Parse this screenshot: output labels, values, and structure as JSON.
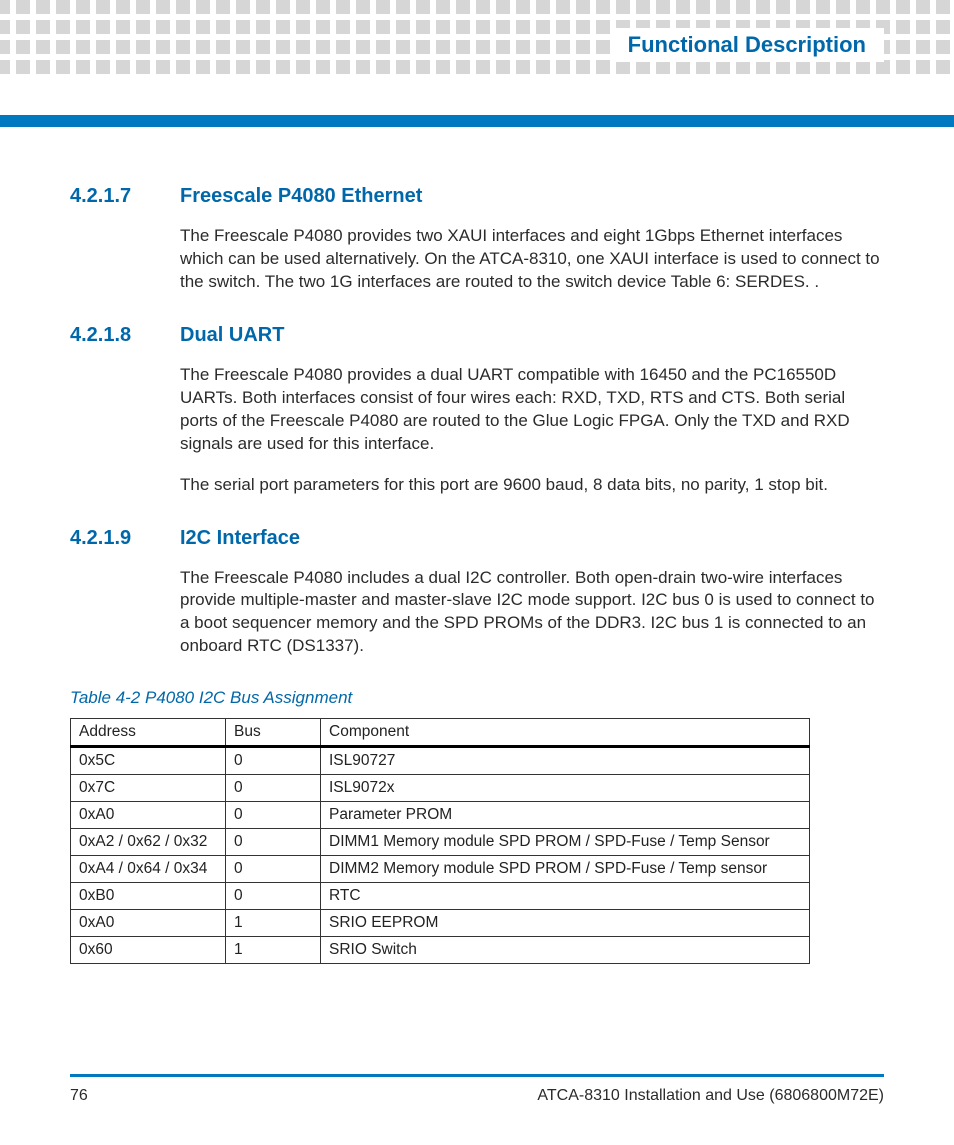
{
  "header": {
    "section_title": "Functional Description"
  },
  "sections": [
    {
      "number": "4.2.1.7",
      "title": "Freescale P4080 Ethernet",
      "paragraphs": [
        "The Freescale P4080 provides two XAUI interfaces and eight 1Gbps Ethernet interfaces which can be used alternatively. On the ATCA-8310, one XAUI interface is used to connect to the switch. The two 1G interfaces are routed to the switch device Table 6: SERDES. ."
      ]
    },
    {
      "number": "4.2.1.8",
      "title": "Dual UART",
      "paragraphs": [
        "The Freescale P4080 provides a dual UART compatible with 16450 and the PC16550D UARTs. Both interfaces consist of four wires each: RXD, TXD, RTS and CTS. Both serial ports of the Freescale P4080 are routed to the Glue Logic FPGA. Only the TXD and RXD signals are used for this interface.",
        "The serial port parameters for this port are 9600 baud, 8 data bits, no parity, 1 stop bit."
      ]
    },
    {
      "number": "4.2.1.9",
      "title": "I2C Interface",
      "paragraphs": [
        "The Freescale P4080 includes a dual I2C controller. Both open-drain two-wire interfaces provide multiple-master and master-slave I2C mode support. I2C bus 0 is used to connect to a boot sequencer memory and the SPD PROMs of the DDR3. I2C bus 1 is connected to an onboard RTC (DS1337)."
      ]
    }
  ],
  "table": {
    "caption": "Table 4-2 P4080 I2C Bus Assignment",
    "headers": [
      "Address",
      "Bus",
      "Component"
    ],
    "rows": [
      [
        "0x5C",
        "0",
        "ISL90727"
      ],
      [
        "0x7C",
        "0",
        "ISL9072x"
      ],
      [
        "0xA0",
        "0",
        "Parameter PROM"
      ],
      [
        "0xA2 / 0x62 / 0x32",
        "0",
        "DIMM1 Memory module SPD PROM / SPD-Fuse / Temp Sensor"
      ],
      [
        "0xA4 / 0x64 / 0x34",
        "0",
        "DIMM2 Memory module SPD PROM / SPD-Fuse / Temp sensor"
      ],
      [
        "0xB0",
        "0",
        "RTC"
      ],
      [
        "0xA0",
        "1",
        "SRIO EEPROM"
      ],
      [
        "0x60",
        "1",
        "SRIO Switch"
      ]
    ]
  },
  "footer": {
    "page_number": "76",
    "doc_title": "ATCA-8310 Installation and Use (6806800M72E)"
  }
}
